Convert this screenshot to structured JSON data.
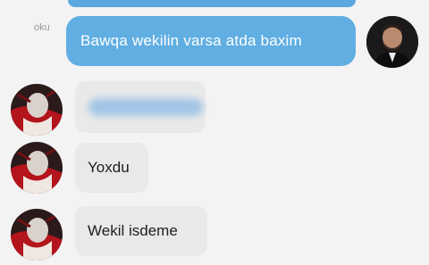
{
  "chat": {
    "status_label": "oku",
    "messages": [
      {
        "side": "out",
        "text": "Bawqa wekilin varsa atda baxim"
      },
      {
        "side": "in",
        "text": ""
      },
      {
        "side": "in",
        "text": "Yoxdu"
      },
      {
        "side": "in",
        "text": "Wekil isdeme"
      }
    ]
  },
  "colors": {
    "background": "#f3f3f3",
    "outgoing_bubble": "#60aee2",
    "incoming_bubble": "#e9e9e9",
    "text_dark": "#1d1d1d"
  }
}
